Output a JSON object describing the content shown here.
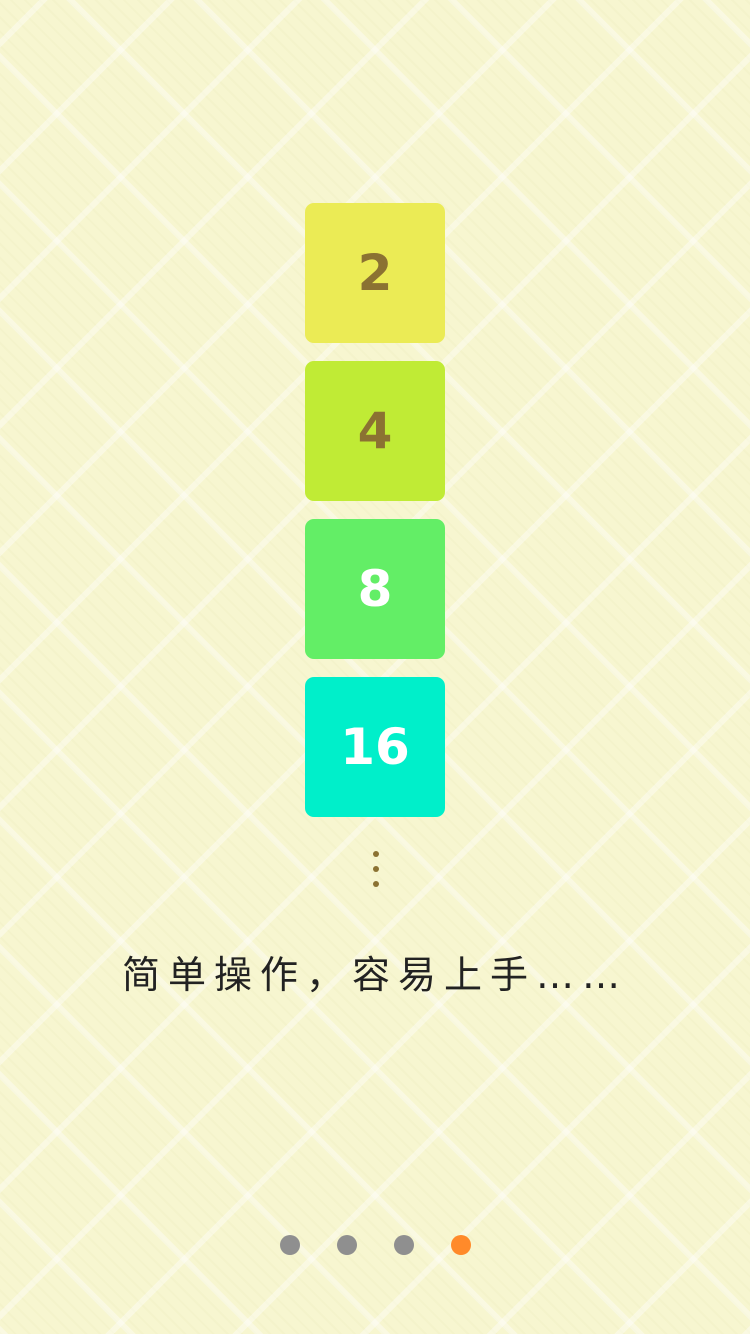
{
  "tiles": [
    {
      "value": "2",
      "bg": "#ebeb55",
      "fg": "#8b7232"
    },
    {
      "value": "4",
      "bg": "#c0eb35",
      "fg": "#8b7232"
    },
    {
      "value": "8",
      "bg": "#63ee66",
      "fg": "#ffffff"
    },
    {
      "value": "16",
      "bg": "#00efca",
      "fg": "#ffffff"
    }
  ],
  "more_indicator": {
    "icon": "vertical-ellipsis-icon",
    "color": "#8b7232"
  },
  "caption": "简单操作，容易上手……",
  "pager": {
    "count": 4,
    "active_index": 3,
    "inactive_color": "#8f8f8f",
    "active_color": "#ff8a2a"
  }
}
